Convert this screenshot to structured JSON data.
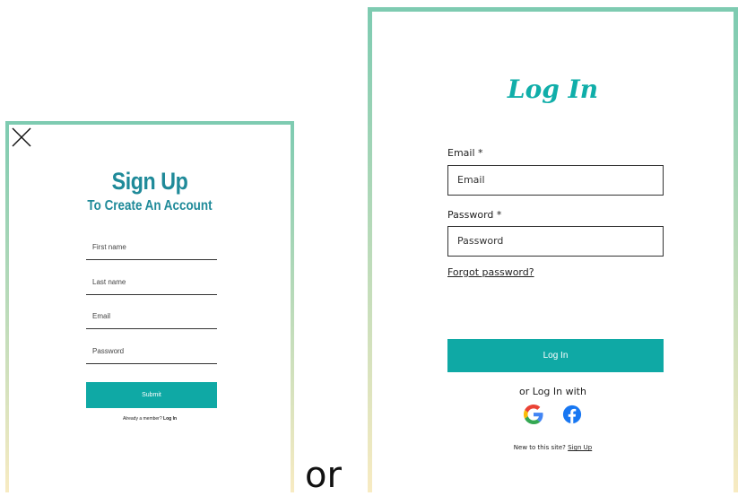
{
  "signup": {
    "title": "Sign Up",
    "subtitle": "To Create An Account",
    "fields": {
      "first_name": "First name",
      "last_name": "Last name",
      "email": "Email",
      "password": "Password"
    },
    "submit_label": "Submit",
    "member_prompt": "Already a member?",
    "login_link": "Log In"
  },
  "separator": "or",
  "login": {
    "title": "Log In",
    "email_label": "Email *",
    "email_placeholder": "Email",
    "password_label": "Password *",
    "password_placeholder": "Password",
    "forgot_password": "Forgot password?",
    "button_label": "Log In",
    "social_prompt": "or Log In with",
    "social_icons": [
      "google-icon",
      "facebook-icon"
    ],
    "new_prompt": "New to this site?",
    "signup_link": "Sign Up"
  },
  "colors": {
    "accent": "#0fa9a5",
    "heading": "#1f8a99",
    "border_top": "#7ecbb1",
    "border_bottom": "#f8ebc2",
    "facebook": "#1877f2"
  }
}
